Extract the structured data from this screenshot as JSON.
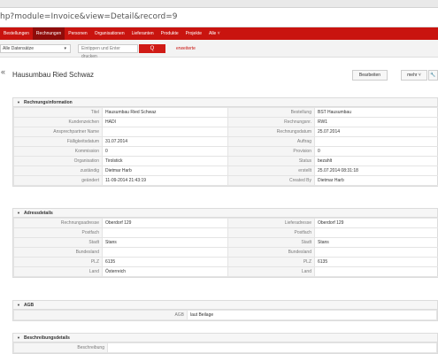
{
  "browser": {
    "url": "hp?module=Invoice&view=Detail&record=9"
  },
  "nav": {
    "items": [
      "Bestellungen",
      "Rechnungen",
      "Personen",
      "Organisationen",
      "Lieferanten",
      "Produkte",
      "Projekte",
      "Alle ˅"
    ],
    "active": 1
  },
  "search": {
    "datasets": "Alle Datensätze",
    "placeholder": "Eintippen und Enter drucken",
    "button_icon": "Q",
    "advanced": "erweiterte"
  },
  "record": {
    "back_icon": "«",
    "title": "Hausumbau Ried Schwaz",
    "edit_label": "Bearbeiten",
    "more_label": "mehr ˅",
    "wrench_icon": "🔧"
  },
  "blocks": [
    {
      "title": "Rechnungsinformation",
      "rows": [
        [
          {
            "l": "Titel",
            "v": "Hausumbau Ried Schwaz"
          },
          {
            "l": "Bestellung",
            "v": "BST Hausumbau",
            "link": true
          }
        ],
        [
          {
            "l": "Kundenzeichen",
            "v": "HADI"
          },
          {
            "l": "Rechnungsnr.",
            "v": "RW1"
          }
        ],
        [
          {
            "l": "Ansprechpartner Name",
            "v": ""
          },
          {
            "l": "Rechnungsdatum",
            "v": "25.07.2014"
          }
        ],
        [
          {
            "l": "Fälligkeitsdatum",
            "v": "31.07.2014"
          },
          {
            "l": "Auftrag",
            "v": ""
          }
        ],
        [
          {
            "l": "Kommission",
            "v": "0"
          },
          {
            "l": "Provision",
            "v": "0"
          }
        ],
        [
          {
            "l": "Organisation",
            "v": "Tirolstick",
            "link": true
          },
          {
            "l": "Status",
            "v": "bezahlt"
          }
        ],
        [
          {
            "l": "zuständig",
            "v": "Dietmar Harb",
            "link": true
          },
          {
            "l": "erstellt",
            "v": "25.07.2014 08:31:18"
          }
        ],
        [
          {
            "l": "geändert",
            "v": "11-09-2014 21:43:19"
          },
          {
            "l": "Created By",
            "v": "Dietmar Harb",
            "link": true
          }
        ]
      ]
    },
    {
      "title": "Adressdetails",
      "rows": [
        [
          {
            "l": "Rechnungsadresse",
            "v": "Oberdorf 129"
          },
          {
            "l": "Lieferadresse",
            "v": "Oberdorf 129"
          }
        ],
        [
          {
            "l": "Postfach",
            "v": ""
          },
          {
            "l": "Postfach",
            "v": ""
          }
        ],
        [
          {
            "l": "Stadt",
            "v": "Stans"
          },
          {
            "l": "Stadt",
            "v": "Stans"
          }
        ],
        [
          {
            "l": "Bundesland",
            "v": ""
          },
          {
            "l": "Bundesland",
            "v": ""
          }
        ],
        [
          {
            "l": "PLZ",
            "v": "6135"
          },
          {
            "l": "PLZ",
            "v": "6135"
          }
        ],
        [
          {
            "l": "Land",
            "v": "Österreich"
          },
          {
            "l": "Land",
            "v": ""
          }
        ]
      ]
    },
    {
      "title": "AGB",
      "single": {
        "l": "AGB",
        "v": "laut Beilage"
      }
    },
    {
      "title": "Beschreibungsdetails",
      "single": {
        "l": "Beschreibung",
        "v": ""
      }
    }
  ]
}
